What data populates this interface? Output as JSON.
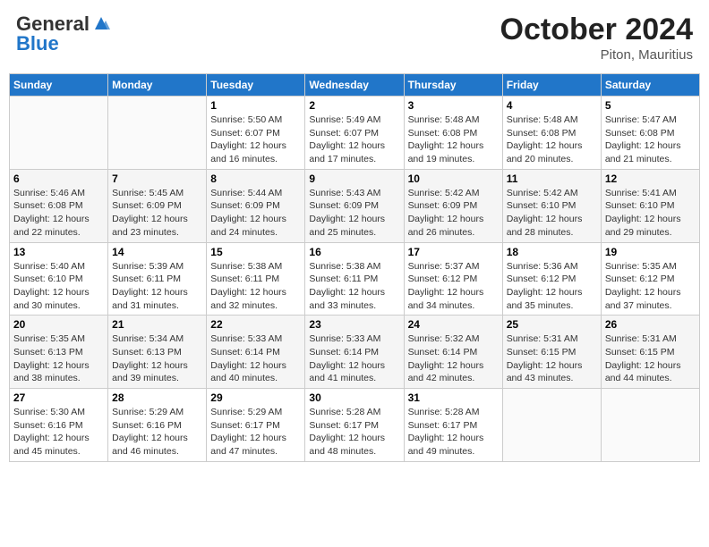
{
  "header": {
    "logo_general": "General",
    "logo_blue": "Blue",
    "title": "October 2024",
    "location": "Piton, Mauritius"
  },
  "calendar": {
    "weekdays": [
      "Sunday",
      "Monday",
      "Tuesday",
      "Wednesday",
      "Thursday",
      "Friday",
      "Saturday"
    ],
    "weeks": [
      [
        {
          "day": "",
          "info": ""
        },
        {
          "day": "",
          "info": ""
        },
        {
          "day": "1",
          "info": "Sunrise: 5:50 AM\nSunset: 6:07 PM\nDaylight: 12 hours and 16 minutes."
        },
        {
          "day": "2",
          "info": "Sunrise: 5:49 AM\nSunset: 6:07 PM\nDaylight: 12 hours and 17 minutes."
        },
        {
          "day": "3",
          "info": "Sunrise: 5:48 AM\nSunset: 6:08 PM\nDaylight: 12 hours and 19 minutes."
        },
        {
          "day": "4",
          "info": "Sunrise: 5:48 AM\nSunset: 6:08 PM\nDaylight: 12 hours and 20 minutes."
        },
        {
          "day": "5",
          "info": "Sunrise: 5:47 AM\nSunset: 6:08 PM\nDaylight: 12 hours and 21 minutes."
        }
      ],
      [
        {
          "day": "6",
          "info": "Sunrise: 5:46 AM\nSunset: 6:08 PM\nDaylight: 12 hours and 22 minutes."
        },
        {
          "day": "7",
          "info": "Sunrise: 5:45 AM\nSunset: 6:09 PM\nDaylight: 12 hours and 23 minutes."
        },
        {
          "day": "8",
          "info": "Sunrise: 5:44 AM\nSunset: 6:09 PM\nDaylight: 12 hours and 24 minutes."
        },
        {
          "day": "9",
          "info": "Sunrise: 5:43 AM\nSunset: 6:09 PM\nDaylight: 12 hours and 25 minutes."
        },
        {
          "day": "10",
          "info": "Sunrise: 5:42 AM\nSunset: 6:09 PM\nDaylight: 12 hours and 26 minutes."
        },
        {
          "day": "11",
          "info": "Sunrise: 5:42 AM\nSunset: 6:10 PM\nDaylight: 12 hours and 28 minutes."
        },
        {
          "day": "12",
          "info": "Sunrise: 5:41 AM\nSunset: 6:10 PM\nDaylight: 12 hours and 29 minutes."
        }
      ],
      [
        {
          "day": "13",
          "info": "Sunrise: 5:40 AM\nSunset: 6:10 PM\nDaylight: 12 hours and 30 minutes."
        },
        {
          "day": "14",
          "info": "Sunrise: 5:39 AM\nSunset: 6:11 PM\nDaylight: 12 hours and 31 minutes."
        },
        {
          "day": "15",
          "info": "Sunrise: 5:38 AM\nSunset: 6:11 PM\nDaylight: 12 hours and 32 minutes."
        },
        {
          "day": "16",
          "info": "Sunrise: 5:38 AM\nSunset: 6:11 PM\nDaylight: 12 hours and 33 minutes."
        },
        {
          "day": "17",
          "info": "Sunrise: 5:37 AM\nSunset: 6:12 PM\nDaylight: 12 hours and 34 minutes."
        },
        {
          "day": "18",
          "info": "Sunrise: 5:36 AM\nSunset: 6:12 PM\nDaylight: 12 hours and 35 minutes."
        },
        {
          "day": "19",
          "info": "Sunrise: 5:35 AM\nSunset: 6:12 PM\nDaylight: 12 hours and 37 minutes."
        }
      ],
      [
        {
          "day": "20",
          "info": "Sunrise: 5:35 AM\nSunset: 6:13 PM\nDaylight: 12 hours and 38 minutes."
        },
        {
          "day": "21",
          "info": "Sunrise: 5:34 AM\nSunset: 6:13 PM\nDaylight: 12 hours and 39 minutes."
        },
        {
          "day": "22",
          "info": "Sunrise: 5:33 AM\nSunset: 6:14 PM\nDaylight: 12 hours and 40 minutes."
        },
        {
          "day": "23",
          "info": "Sunrise: 5:33 AM\nSunset: 6:14 PM\nDaylight: 12 hours and 41 minutes."
        },
        {
          "day": "24",
          "info": "Sunrise: 5:32 AM\nSunset: 6:14 PM\nDaylight: 12 hours and 42 minutes."
        },
        {
          "day": "25",
          "info": "Sunrise: 5:31 AM\nSunset: 6:15 PM\nDaylight: 12 hours and 43 minutes."
        },
        {
          "day": "26",
          "info": "Sunrise: 5:31 AM\nSunset: 6:15 PM\nDaylight: 12 hours and 44 minutes."
        }
      ],
      [
        {
          "day": "27",
          "info": "Sunrise: 5:30 AM\nSunset: 6:16 PM\nDaylight: 12 hours and 45 minutes."
        },
        {
          "day": "28",
          "info": "Sunrise: 5:29 AM\nSunset: 6:16 PM\nDaylight: 12 hours and 46 minutes."
        },
        {
          "day": "29",
          "info": "Sunrise: 5:29 AM\nSunset: 6:17 PM\nDaylight: 12 hours and 47 minutes."
        },
        {
          "day": "30",
          "info": "Sunrise: 5:28 AM\nSunset: 6:17 PM\nDaylight: 12 hours and 48 minutes."
        },
        {
          "day": "31",
          "info": "Sunrise: 5:28 AM\nSunset: 6:17 PM\nDaylight: 12 hours and 49 minutes."
        },
        {
          "day": "",
          "info": ""
        },
        {
          "day": "",
          "info": ""
        }
      ]
    ]
  }
}
